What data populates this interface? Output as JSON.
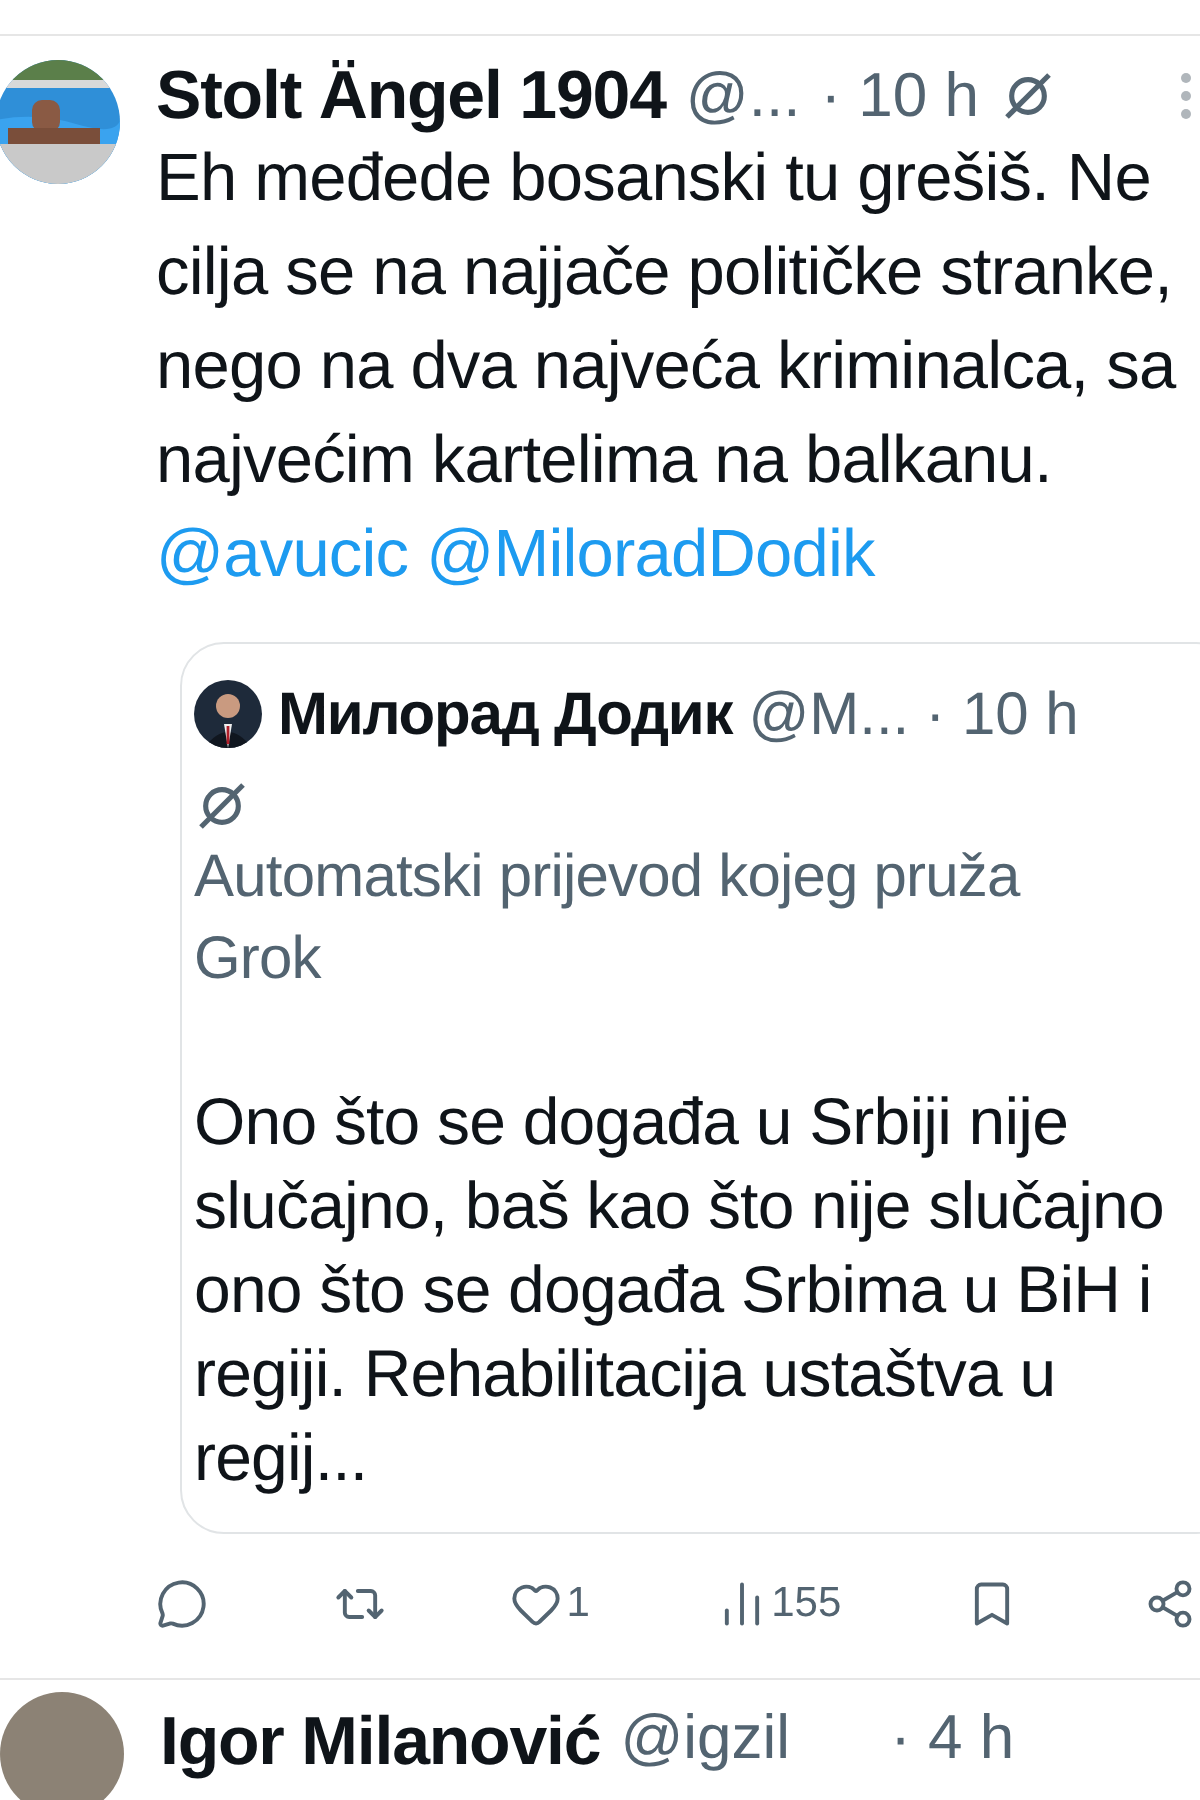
{
  "tweet": {
    "name": "Stolt Ängel 1904",
    "handle": "@...",
    "time": "· 10 h",
    "text": "Eh međede bosanski tu grešiš. Ne cilja se na najjače političke stranke, nego na dva najveća kriminalca, sa najvećim kartelima na balkanu.",
    "mentions": [
      "@avucic",
      "@MiloradDodik"
    ],
    "quote": {
      "name": "Милорад Додик",
      "handle": "@M...",
      "time": "· 10 h",
      "translation_note": "Automatski prijevod kojeg pruža Grok",
      "text": "Ono što se događa u Srbiji nije slučajno, baš kao što nije slučajno ono što se događa Srbima u BiH i regiji. Rehabilitacija ustaštva u regij..."
    },
    "actions": [
      {
        "kind": "reply"
      },
      {
        "kind": "repost"
      },
      {
        "kind": "like",
        "count": "1"
      },
      {
        "kind": "views",
        "count": "155"
      },
      {
        "kind": "bookmark"
      },
      {
        "kind": "share"
      }
    ]
  },
  "next_tweet": {
    "name": "Igor Milanović",
    "handle": "@igzil",
    "time": "· 4 h"
  }
}
